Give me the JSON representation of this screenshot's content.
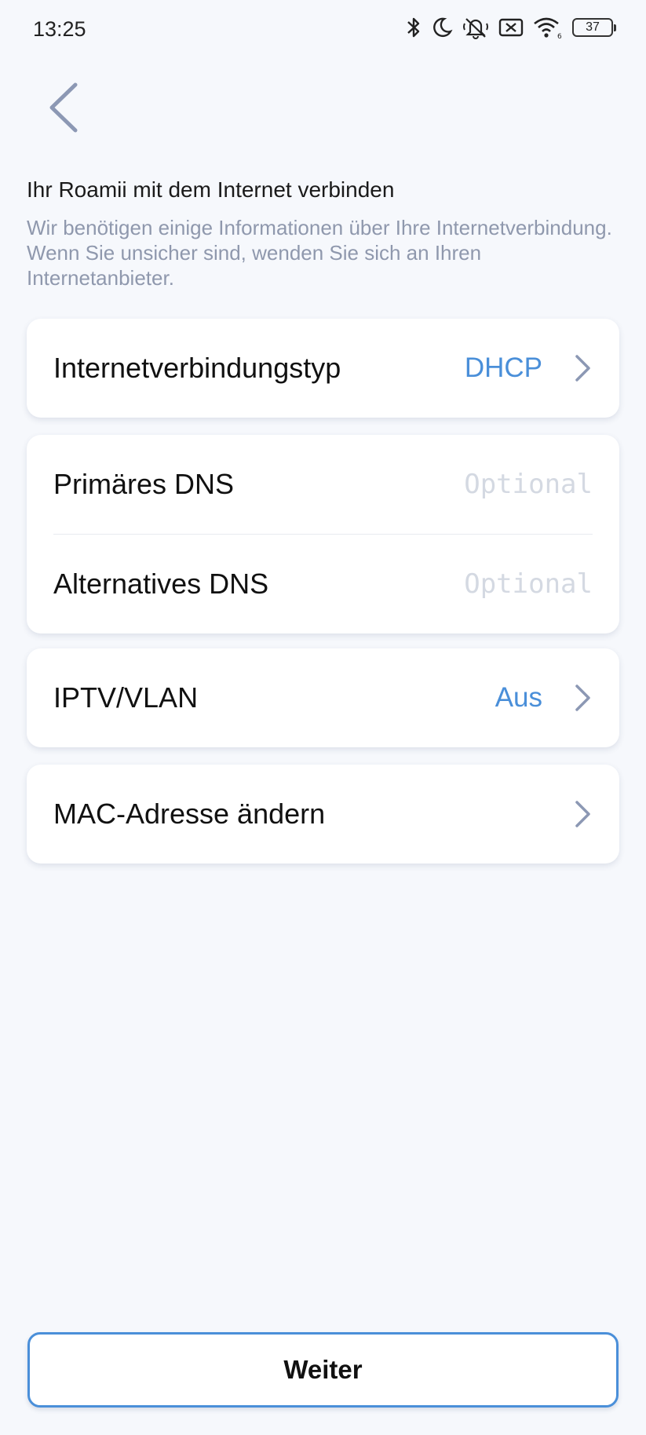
{
  "status_bar": {
    "time": "13:25",
    "battery": "37",
    "icons": [
      "bluetooth-icon",
      "moon-icon",
      "bell-off-icon",
      "sim-off-icon",
      "wifi-icon",
      "battery-icon"
    ]
  },
  "header": {
    "back_icon": "chevron-left-icon"
  },
  "intro": {
    "title": "Ihr Roamii mit dem Internet verbinden",
    "description": "Wir benötigen einige Informationen über Ihre Internetverbindung. Wenn Sie unsicher sind, wenden Sie sich an Ihren Internetanbieter."
  },
  "settings": {
    "connection_type": {
      "label": "Internetverbindungstyp",
      "value": "DHCP"
    },
    "primary_dns": {
      "label": "Primäres DNS",
      "placeholder": "Optional"
    },
    "alternative_dns": {
      "label": "Alternatives DNS",
      "placeholder": "Optional"
    },
    "iptv": {
      "label": "IPTV/VLAN",
      "value": "Aus"
    },
    "mac": {
      "label": "MAC-Adresse ändern"
    }
  },
  "footer": {
    "next_label": "Weiter"
  },
  "colors": {
    "accent": "#4a8fd9",
    "background": "#f6f8fc",
    "muted_text": "#8f98ad",
    "chevron": "#8c98b4"
  }
}
